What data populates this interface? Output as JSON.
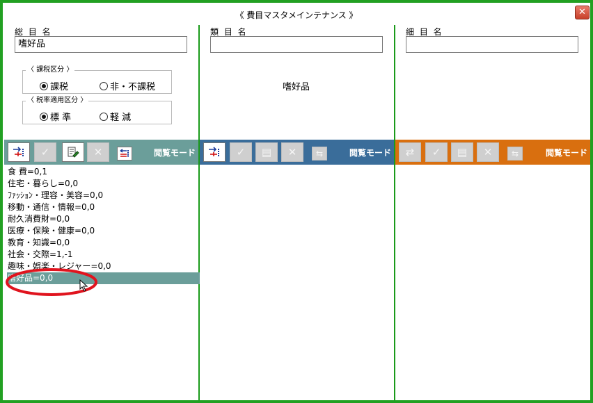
{
  "window": {
    "title": "《 費目マスタメインテナンス 》",
    "close_glyph": "✕"
  },
  "columns": [
    {
      "label": "総 目 名",
      "value": "嗜好品"
    },
    {
      "label": "類 目 名",
      "value": ""
    },
    {
      "label": "細 目 名",
      "value": ""
    }
  ],
  "middle_text": "嗜好品",
  "tax": {
    "legend": "〈 課税区分 〉",
    "options": [
      {
        "label": "課税",
        "selected": true
      },
      {
        "label": "非・不課税",
        "selected": false
      }
    ]
  },
  "rate": {
    "legend": "〈 税率適用区分 〉",
    "options": [
      {
        "label": "標 準",
        "selected": true
      },
      {
        "label": "軽 減",
        "selected": false
      }
    ]
  },
  "toolbars": [
    {
      "color": "#6b9e9a",
      "mode": "閲覧モード"
    },
    {
      "color": "#3a6d9a",
      "mode": "閲覧モード"
    },
    {
      "color": "#d96f0f",
      "mode": "閲覧モード"
    }
  ],
  "list_items": [
    "食 費=0,1",
    "住宅・暮らし=0,0",
    "ﾌｧｯｼｮﾝ・理容・美容=0,0",
    "移動・通信・情報=0,0",
    "耐久消費財=0,0",
    "医療・保険・健康=0,0",
    "教育・知識=0,0",
    "社会・交際=1,-1",
    "趣味・娯楽・レジャー=0,0",
    "嗜好品=0,0"
  ],
  "selected_index": 9,
  "colors": {
    "window_border": "#22a022",
    "divider": "#1a9a1a",
    "annotation": "#e0141e",
    "selection": "#6b9e9a"
  }
}
